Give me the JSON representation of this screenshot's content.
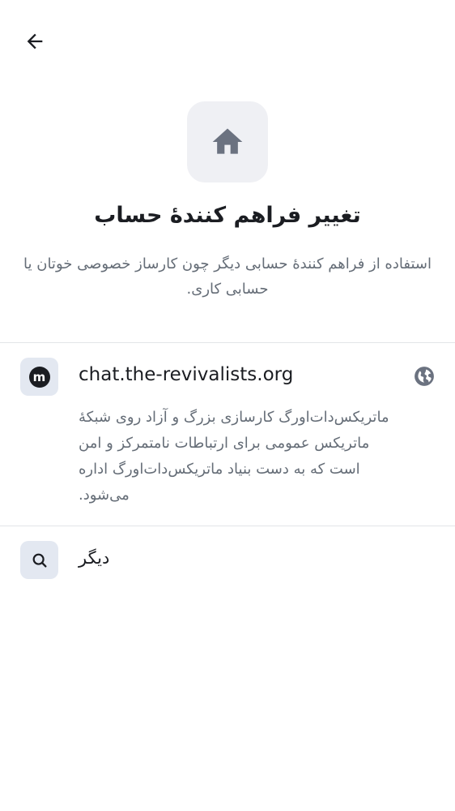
{
  "header": {
    "back_icon": "arrow-left-icon"
  },
  "hero": {
    "icon": "home-icon",
    "title": "تغییر فراهم کنندهٔ حساب",
    "subtitle": "استفاده از فراهم کنندهٔ حسابی دیگر چون کارساز خصوصی خوتان یا حسابی کاری."
  },
  "provider": {
    "logo_icon": "matrix-logo-icon",
    "logo_letter": "m",
    "name": "chat.the-revivalists.org",
    "globe_icon": "globe-icon",
    "description": "ماتریکس‌دات‌اورگ کارسازی بزرگ و آزاد روی شبکهٔ ماتریکس عمومی برای ارتباطات نامتمرکز و امن است که به دست بنیاد ماتریکس‌دات‌اورگ اداره می‌شود."
  },
  "other": {
    "icon": "search-icon",
    "label": "دیگر"
  },
  "colors": {
    "text_primary": "#1b1d22",
    "text_secondary": "#656d77",
    "icon_bg": "#eff0f4",
    "logo_bg": "#e3e8f1",
    "divider": "#e3e5e8",
    "icon_gray": "#6b7280"
  }
}
